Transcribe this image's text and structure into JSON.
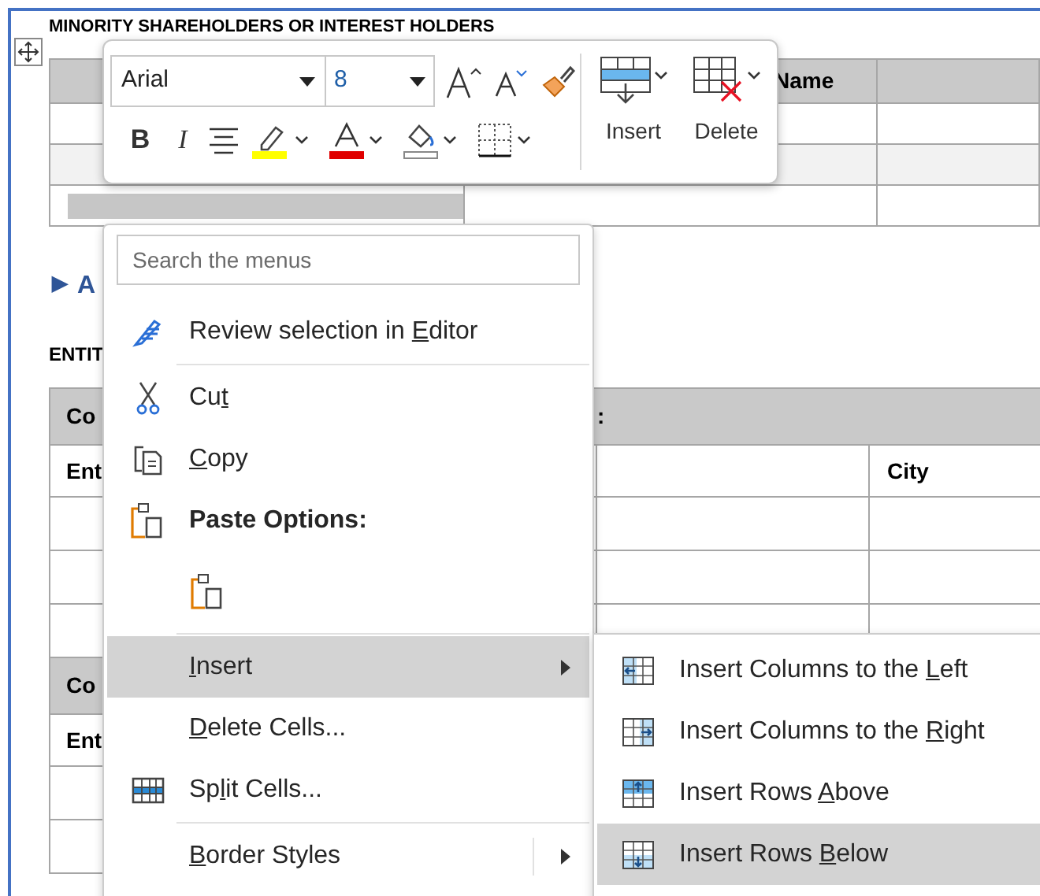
{
  "document": {
    "heading": "MINORITY SHAREHOLDERS OR INTEREST HOLDERS",
    "table_1": {
      "header_cell": "Name",
      "rows": [
        {
          "selected": false
        },
        {
          "selected": false
        },
        {
          "selected": true
        }
      ]
    },
    "expander": {
      "arrow": "▶",
      "label": "A"
    },
    "heading_2": "ENTIT",
    "table_2": {
      "rows": [
        {
          "kind": "header",
          "cells": [
            "Co",
            ":"
          ]
        },
        {
          "kind": "labels",
          "cells": [
            "Ent",
            "City"
          ]
        },
        {
          "kind": "blank"
        },
        {
          "kind": "blank"
        },
        {
          "kind": "blank"
        },
        {
          "kind": "header",
          "cells": [
            "Co"
          ]
        },
        {
          "kind": "labels",
          "cells": [
            "Ent"
          ]
        },
        {
          "kind": "blank"
        },
        {
          "kind": "blank"
        }
      ]
    }
  },
  "mini_toolbar": {
    "font": "Arial",
    "size": "8",
    "bold": "B",
    "italic": "I",
    "insert": "Insert",
    "delete": "Delete"
  },
  "context_menu": {
    "search": {
      "placeholder": "Search the menus"
    },
    "items": [
      {
        "kind": "item",
        "label": {
          "before": "Review selection in ",
          "key": "E",
          "after": "ditor"
        },
        "selected": false,
        "submenu": false
      },
      {
        "kind": "separator"
      },
      {
        "kind": "item",
        "label": {
          "before": "Cu",
          "key": "t"
        },
        "selected": false,
        "submenu": false
      },
      {
        "kind": "item",
        "label": {
          "key": "C",
          "after": "opy"
        },
        "selected": false,
        "submenu": false
      },
      {
        "kind": "header",
        "label": {
          "before": "Paste Options:"
        }
      },
      {
        "kind": "paste"
      },
      {
        "kind": "separator"
      },
      {
        "kind": "item",
        "label": {
          "key": "I",
          "after": "nsert"
        },
        "selected": true,
        "submenu": true
      },
      {
        "kind": "item",
        "label": {
          "key": "D",
          "after": "elete Cells..."
        },
        "selected": false,
        "submenu": false
      },
      {
        "kind": "item",
        "label": {
          "before": "Sp",
          "key": "l",
          "after": "it Cells..."
        },
        "selected": false,
        "submenu": false
      },
      {
        "kind": "separator"
      },
      {
        "kind": "item",
        "label": {
          "key": "B",
          "after": "order Styles"
        },
        "selected": false,
        "submenu": true
      }
    ]
  },
  "submenu": {
    "items": [
      {
        "label": {
          "before": "Insert Columns to the ",
          "key": "L",
          "after": "eft"
        },
        "selected": false
      },
      {
        "label": {
          "before": "Insert Columns to the ",
          "key": "R",
          "after": "ight"
        },
        "selected": false
      },
      {
        "label": {
          "before": "Insert Rows ",
          "key": "A",
          "after": "bove"
        },
        "selected": false
      },
      {
        "label": {
          "before": "Insert Rows ",
          "key": "B",
          "after": "elow"
        },
        "selected": true
      }
    ]
  }
}
